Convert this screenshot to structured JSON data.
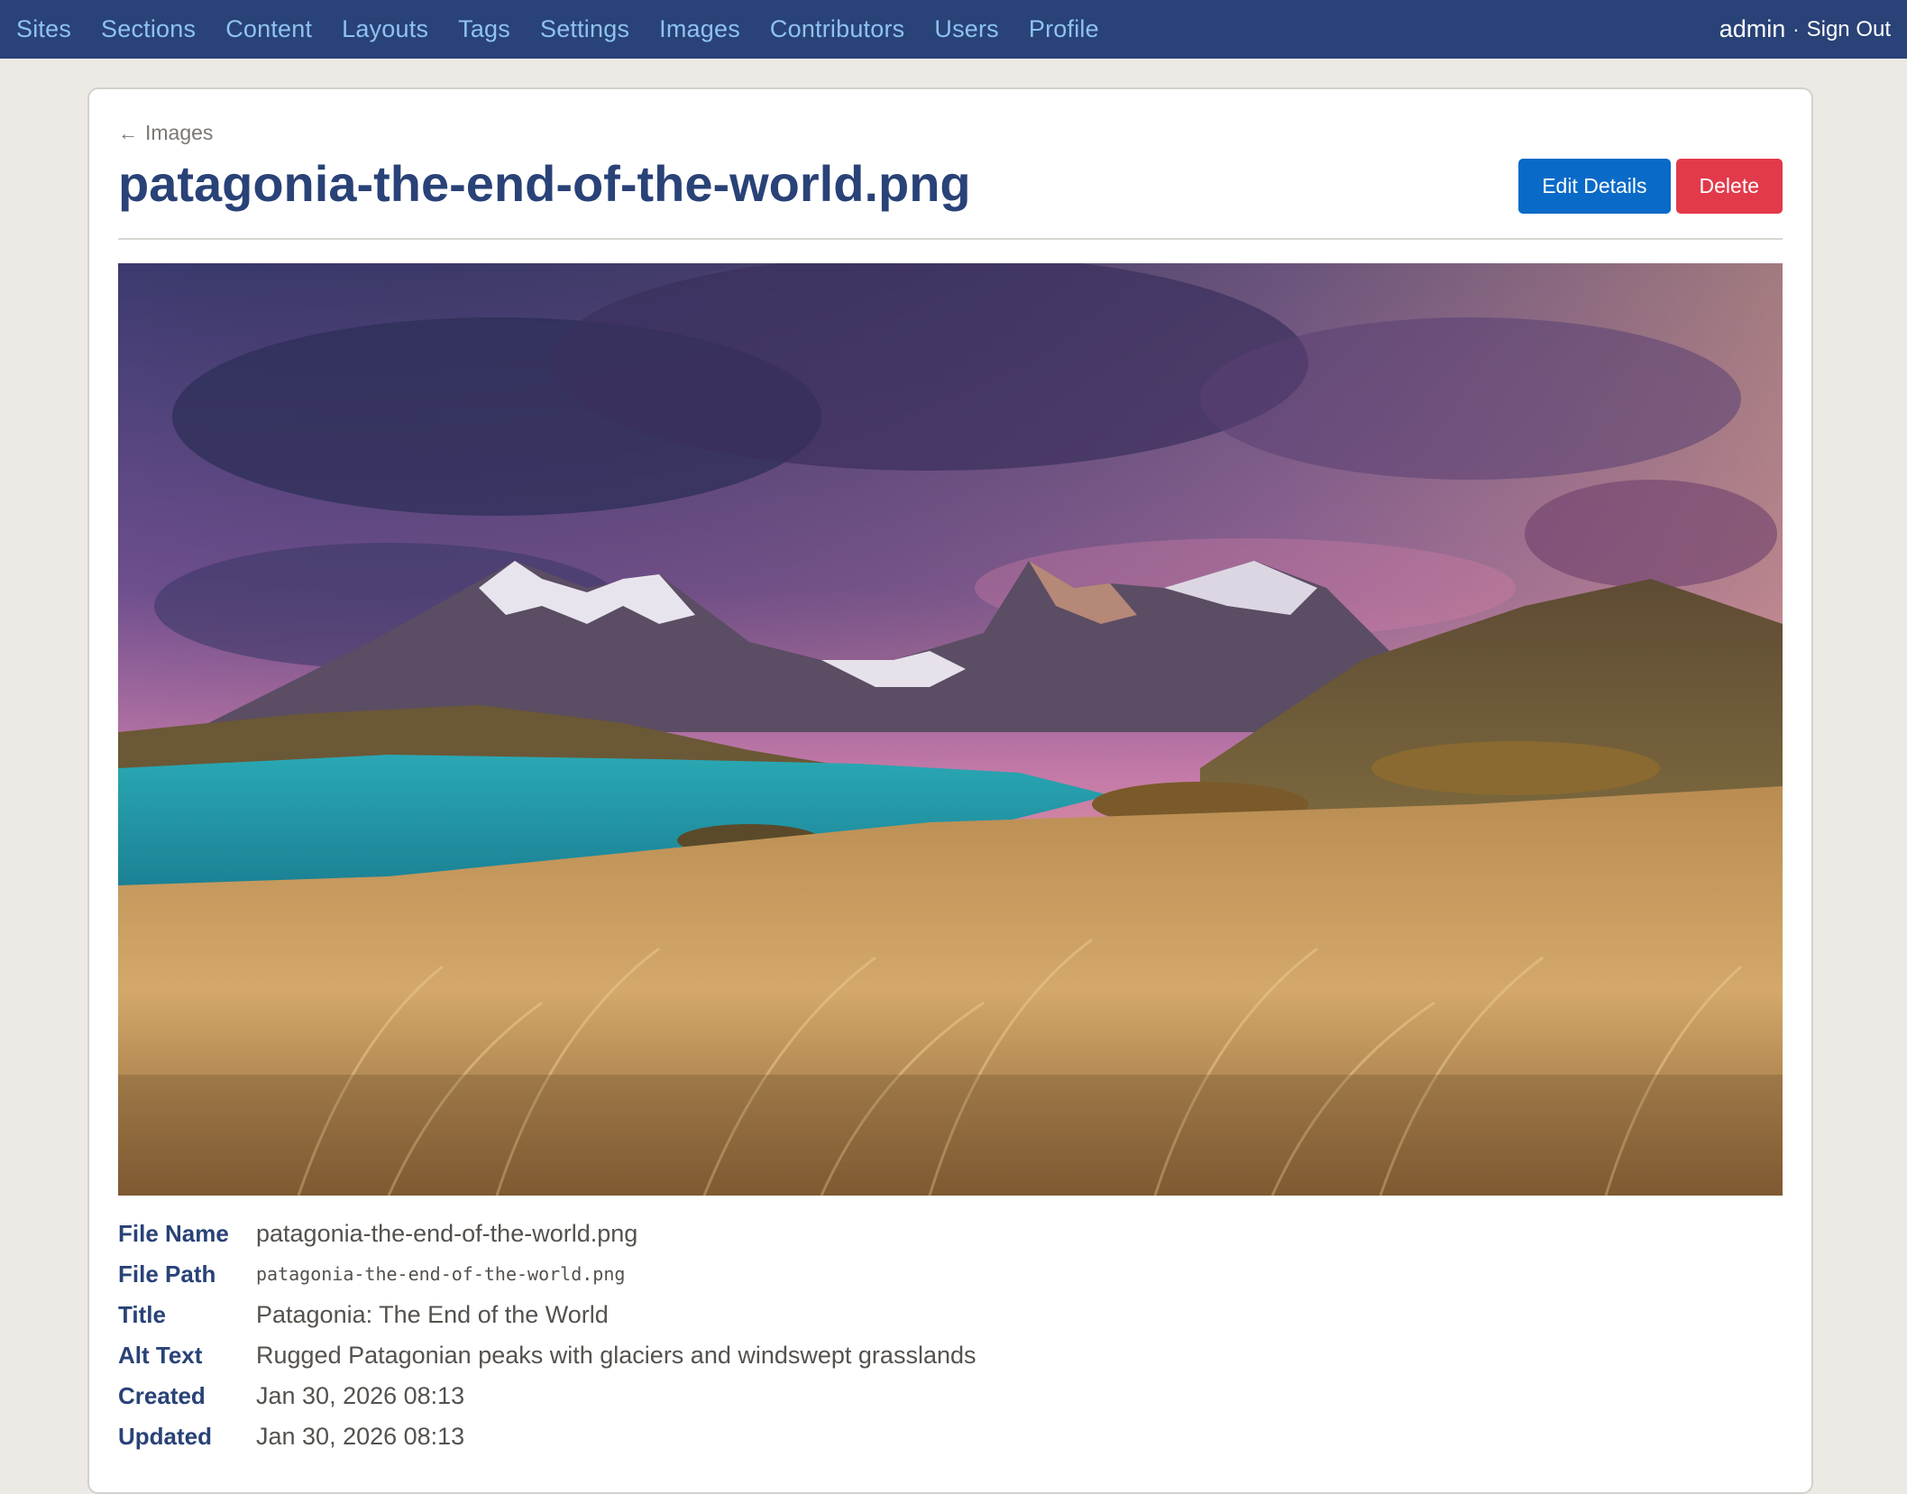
{
  "nav": {
    "links": [
      "Sites",
      "Sections",
      "Content",
      "Layouts",
      "Tags",
      "Settings",
      "Images",
      "Contributors",
      "Users",
      "Profile"
    ],
    "user": "admin",
    "separator": "·",
    "signout": "Sign Out"
  },
  "page": {
    "back_label": "Images",
    "back_icon": "arrow-left-icon",
    "title": "patagonia-the-end-of-the-world.png",
    "edit_label": "Edit Details",
    "delete_label": "Delete"
  },
  "details": [
    {
      "label": "File Name",
      "value": "patagonia-the-end-of-the-world.png"
    },
    {
      "label": "File Path",
      "value": "patagonia-the-end-of-the-world.png"
    },
    {
      "label": "Title",
      "value": "Patagonia: The End of the World"
    },
    {
      "label": "Alt Text",
      "value": "Rugged Patagonian peaks with glaciers and windswept grasslands"
    },
    {
      "label": "Created",
      "value": "Jan 30, 2026 08:13"
    },
    {
      "label": "Updated",
      "value": "Jan 30, 2026 08:13"
    }
  ],
  "colors": {
    "nav_bg": "#294277",
    "nav_link": "#8ec2ef",
    "title": "#294277",
    "primary": "#0a6ac7",
    "danger": "#e23a4a",
    "page_bg": "#ede9e5"
  }
}
